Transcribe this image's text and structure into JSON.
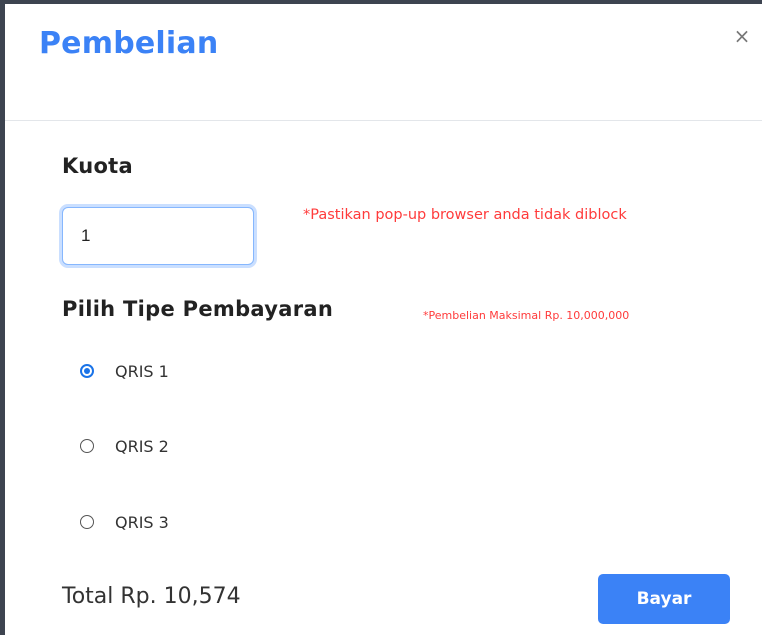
{
  "modal": {
    "title": "Pembelian",
    "close_symbol": "×"
  },
  "quota": {
    "label": "Kuota",
    "value": "1",
    "popup_warning": "*Pastikan pop-up browser anda tidak diblock"
  },
  "payment": {
    "label": "Pilih Tipe Pembayaran",
    "max_note": "*Pembelian Maksimal Rp. 10,000,000",
    "options": [
      {
        "label": "QRIS 1",
        "selected": true
      },
      {
        "label": "QRIS 2",
        "selected": false
      },
      {
        "label": "QRIS 3",
        "selected": false
      }
    ]
  },
  "footer": {
    "total": "Total Rp. 10,574",
    "pay_label": "Bayar"
  },
  "colors": {
    "accent": "#3b82f6",
    "warning": "#ff3b3b",
    "frame": "#3d4450"
  },
  "icons": {
    "close": "close-icon"
  }
}
